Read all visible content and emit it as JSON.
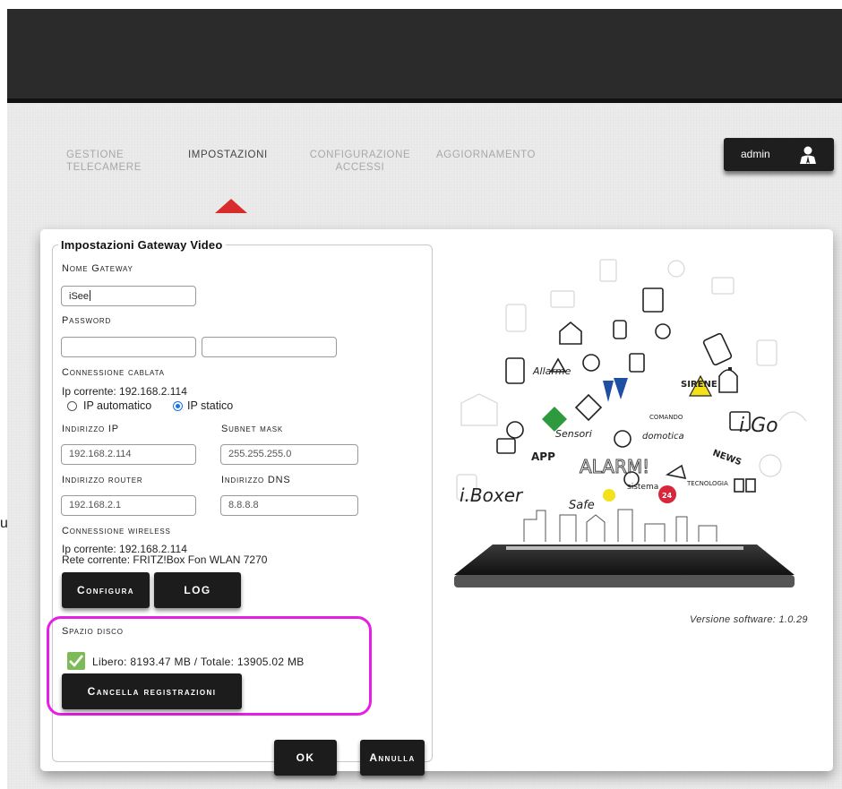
{
  "stray_text": "u",
  "tabs": [
    {
      "line1": "Gestione",
      "line2": "telecamere"
    },
    {
      "line1": "Impostazioni",
      "line2": ""
    },
    {
      "line1": "Configurazione",
      "line2": "accessi"
    },
    {
      "line1": "Aggiornamento",
      "line2": ""
    }
  ],
  "active_tab": "Impostazioni",
  "user": {
    "name": "admin",
    "icon": "user-icon"
  },
  "panel": {
    "legend": "Impostazioni Gateway Video",
    "nome_gateway_label": "Nome Gateway",
    "nome_gateway_value": "iSee",
    "password_label": "Password",
    "password_value": "",
    "password_confirm_value": "",
    "cablata_label": "Connessione cablata",
    "ip_corrente_cablata": "Ip corrente: 192.168.2.114",
    "radio_auto": "IP automatico",
    "radio_static": "IP statico",
    "radio_selected": "IP statico",
    "ip_label": "Indirizzo IP",
    "ip_value": "192.168.2.114",
    "subnet_label": "Subnet mask",
    "subnet_value": "255.255.255.0",
    "router_label": "Indirizzo router",
    "router_value": "192.168.2.1",
    "dns_label": "Indirizzo DNS",
    "dns_value": "8.8.8.8",
    "wireless_label": "Connessione wireless",
    "ip_corrente_wireless": "Ip corrente: 192.168.2.114",
    "rete_corrente": "Rete corrente: FRITZ!Box Fon WLAN 7270",
    "configura_button": "Configura",
    "log_button": "LOG",
    "spazio_disco_label": "Spazio disco",
    "disk_info": "Libero: 8193.47 MB / Totale: 13905.02 MB",
    "cancella_button": "Cancella registrazioni",
    "ok_button": "OK",
    "annulla_button": "Annulla"
  },
  "illustration_words": [
    "Allarme",
    "Sensori",
    "APP",
    "ALARM!",
    "i.Boxer",
    "i.Go",
    "SIRENE",
    "domotica",
    "sistema",
    "Safe",
    "NEWS",
    "COMANDO",
    "TECNOLOGIA",
    "24"
  ],
  "version": "Versione software: 1.0.29",
  "colors": {
    "topbar": "#2b2b2b",
    "accent_caret": "#d82b2b",
    "highlight": "#e61ee6",
    "radio": "#1a73e8",
    "check": "#7dbb5a"
  }
}
